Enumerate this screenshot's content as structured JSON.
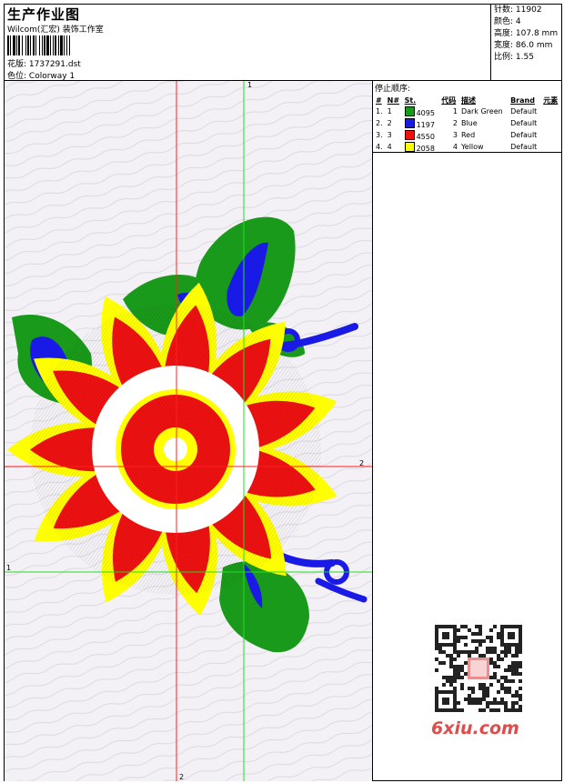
{
  "header": {
    "title": "生产作业图",
    "company": "Wilcom(汇宏) 装饰工作室",
    "file_label": "花版:",
    "file_value": "1737291.dst",
    "colorway_label": "色位:",
    "colorway_value": "Colorway 1"
  },
  "stats": [
    {
      "label": "针数:",
      "value": "11902"
    },
    {
      "label": "颜色:",
      "value": "4"
    },
    {
      "label": "高度:",
      "value": "107.8 mm"
    },
    {
      "label": "宽度:",
      "value": "86.0 mm"
    },
    {
      "label": "比例:",
      "value": "1.55"
    }
  ],
  "stop_sequence": {
    "title": "停止顺序:",
    "columns": [
      "#",
      "N#",
      "St.",
      "代码",
      "描述",
      "Brand",
      "元素"
    ],
    "rows": [
      {
        "idx": "1.",
        "n": "1",
        "stitches": "4095",
        "code": "1",
        "description": "Dark Green",
        "brand": "Default",
        "color": "#1a9a1a"
      },
      {
        "idx": "2.",
        "n": "2",
        "stitches": "1197",
        "code": "2",
        "description": "Blue",
        "brand": "Default",
        "color": "#1a1ae6"
      },
      {
        "idx": "3.",
        "n": "3",
        "stitches": "4550",
        "code": "3",
        "description": "Red",
        "brand": "Default",
        "color": "#ee1111"
      },
      {
        "idx": "4.",
        "n": "4",
        "stitches": "2058",
        "code": "4",
        "description": "Yellow",
        "brand": "Default",
        "color": "#ffff00"
      }
    ]
  },
  "guides": {
    "label_1": "1",
    "label_2": "2"
  },
  "watermark": {
    "site": "6xiu.com"
  }
}
